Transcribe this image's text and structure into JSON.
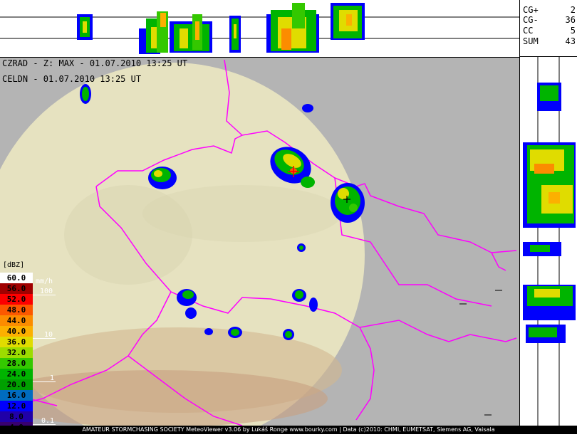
{
  "header": {
    "line1": "CZRAD - Z: MAX - 01.07.2010 13:25 UT",
    "line2": "CELDN - 01.07.2010 13:25 UT"
  },
  "stats": [
    {
      "key": "CG+",
      "value": "2"
    },
    {
      "key": "CG-",
      "value": "36"
    },
    {
      "key": "CC",
      "value": "5"
    },
    {
      "key": "SUM",
      "value": "43"
    }
  ],
  "legend": {
    "unit": "[dBZ]",
    "rate_unit": "mm/h",
    "levels": [
      {
        "label": "60.0",
        "color": "#ffffff",
        "text": "#000000"
      },
      {
        "label": "56.0",
        "color": "#a00000",
        "text": "#000000"
      },
      {
        "label": "52.0",
        "color": "#fc0000",
        "text": "#000000"
      },
      {
        "label": "48.0",
        "color": "#fc5800",
        "text": "#000000"
      },
      {
        "label": "44.0",
        "color": "#fc8c00",
        "text": "#000000"
      },
      {
        "label": "40.0",
        "color": "#fcb000",
        "text": "#000000"
      },
      {
        "label": "36.0",
        "color": "#e0dc00",
        "text": "#000000"
      },
      {
        "label": "32.0",
        "color": "#9cdc00",
        "text": "#000000"
      },
      {
        "label": "28.0",
        "color": "#34c800",
        "text": "#000000"
      },
      {
        "label": "24.0",
        "color": "#00b400",
        "text": "#000000"
      },
      {
        "label": "20.0",
        "color": "#00a000",
        "text": "#000000"
      },
      {
        "label": "16.0",
        "color": "#006cc0",
        "text": "#000000"
      },
      {
        "label": "12.0",
        "color": "#0000fc",
        "text": "#000000"
      },
      {
        "label": "8.0",
        "color": "#2000a8",
        "text": "#000000"
      },
      {
        "label": "4.0",
        "color": "#380070",
        "text": "#000000"
      }
    ],
    "rates": [
      "100",
      "10",
      "1",
      "0.1"
    ]
  },
  "footer": "AMATEUR STORMCHASING SOCIETY MeteoViewer v3.06 by Lukáš Ronge www.bourky.com | Data (c)2010: CHMI, EUMETSAT, Siemens AG, Vaisala",
  "colors": {
    "border_line": "#ff00ff",
    "radar_disc": "#e6e2c0",
    "outside": "#b4b4b4"
  }
}
